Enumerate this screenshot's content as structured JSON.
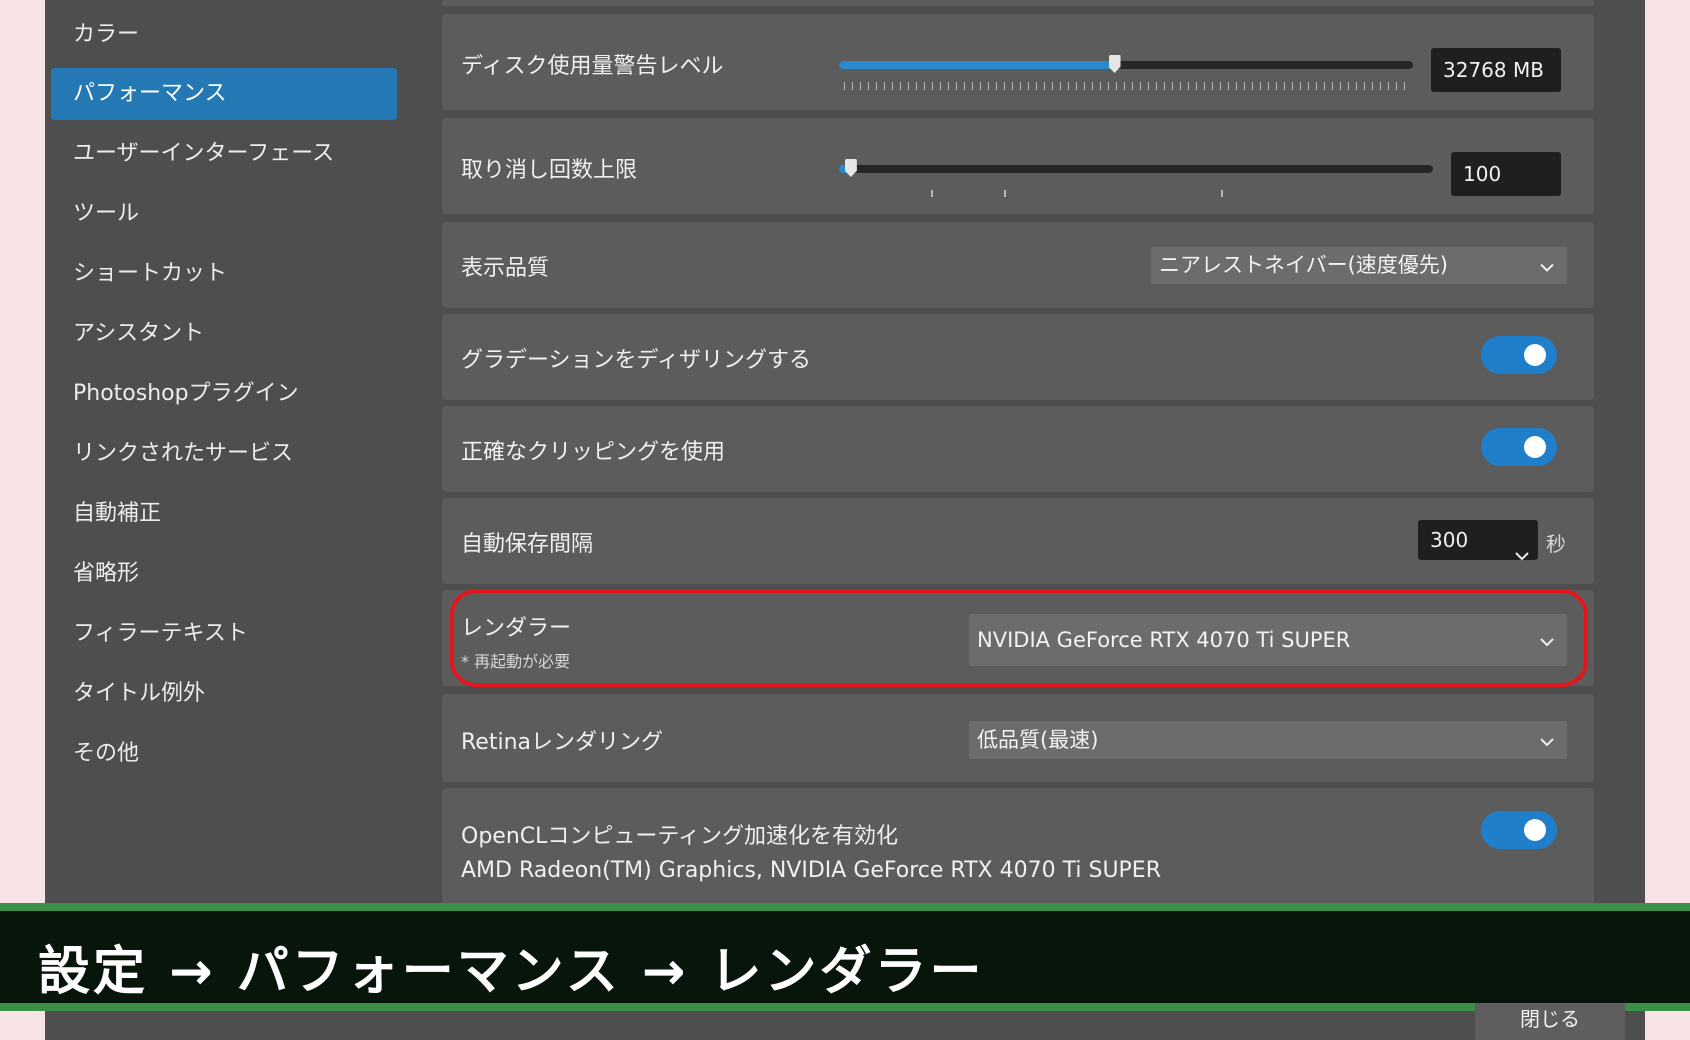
{
  "sidebar": {
    "items": [
      {
        "label": "カラー"
      },
      {
        "label": "パフォーマンス"
      },
      {
        "label": "ユーザーインターフェース"
      },
      {
        "label": "ツール"
      },
      {
        "label": "ショートカット"
      },
      {
        "label": "アシスタント"
      },
      {
        "label": "Photoshopプラグイン"
      },
      {
        "label": "リンクされたサービス"
      },
      {
        "label": "自動補正"
      },
      {
        "label": "省略形"
      },
      {
        "label": "フィラーテキスト"
      },
      {
        "label": "タイトル例外"
      },
      {
        "label": "その他"
      }
    ],
    "active_index": 1
  },
  "settings": {
    "disk_warning": {
      "label": "ディスク使用量警告レベル",
      "value": "32768 MB",
      "slider_level": 0.48
    },
    "undo_limit": {
      "label": "取り消し回数上限",
      "value": "100",
      "slider_level": 0.02
    },
    "display_quality": {
      "label": "表示品質",
      "selected": "ニアレストネイバー(速度優先)"
    },
    "dither_gradients": {
      "label": "グラデーションをディザリングする",
      "on": true
    },
    "precise_clipping": {
      "label": "正確なクリッピングを使用",
      "on": true
    },
    "autosave_interval": {
      "label": "自動保存間隔",
      "selected": "300",
      "unit": "秒"
    },
    "renderer": {
      "label": "レンダラー",
      "note": "* 再起動が必要",
      "selected": "NVIDIA GeForce RTX 4070 Ti SUPER"
    },
    "retina_rendering": {
      "label": "Retinaレンダリング",
      "selected": "低品質(最速)"
    },
    "opencl": {
      "label": "OpenCLコンピューティング加速化を有効化",
      "devices": "AMD Radeon(TM) Graphics, NVIDIA GeForce RTX 4070 Ti SUPER",
      "on": true
    }
  },
  "banner": {
    "text": "設定 → パフォーマンス → レンダラー"
  },
  "footer": {
    "close_label": "閉じる"
  },
  "colors": {
    "accent": "#2479b4",
    "toggle_on": "#1f7fca",
    "highlight": "#e2161f",
    "banner_bg": "#07150a",
    "banner_edge": "#3c8f47"
  }
}
